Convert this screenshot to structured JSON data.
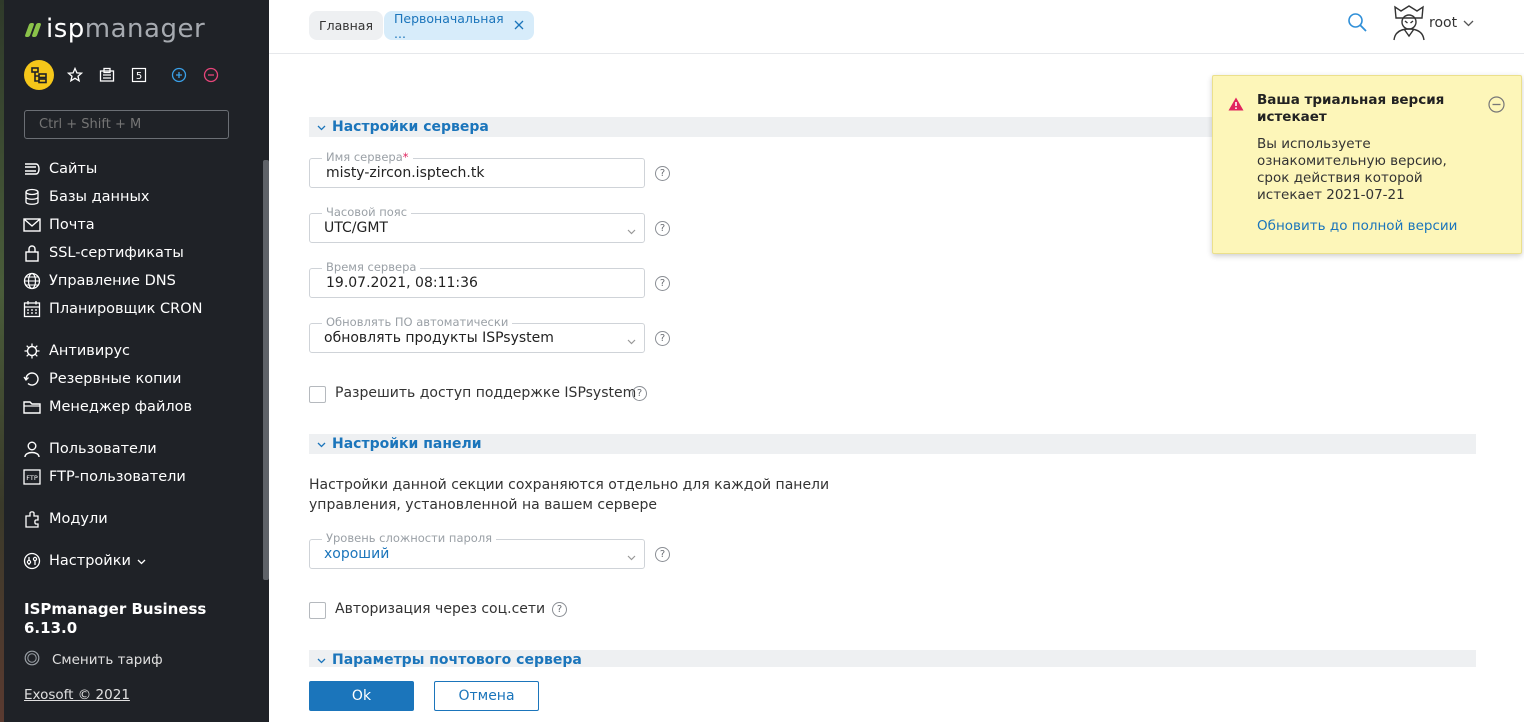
{
  "app": {
    "logo_isp": "isp",
    "logo_manager": "manager",
    "product_name": "ISPmanager Business 6.13.0",
    "change_tariff": "Сменить тариф",
    "copyright": "Exosoft © 2021",
    "quick_badge": "5"
  },
  "search": {
    "placeholder": "Ctrl + Shift + M"
  },
  "sidebar": {
    "items": [
      {
        "label": "Сайты"
      },
      {
        "label": "Базы данных"
      },
      {
        "label": "Почта"
      },
      {
        "label": "SSL-сертификаты"
      },
      {
        "label": "Управление DNS"
      },
      {
        "label": "Планировщик CRON"
      },
      {
        "label": "Антивирус"
      },
      {
        "label": "Резервные копии"
      },
      {
        "label": "Менеджер файлов"
      },
      {
        "label": "Пользователи"
      },
      {
        "label": "FTP-пользователи"
      },
      {
        "label": "Модули"
      },
      {
        "label": "Настройки"
      }
    ]
  },
  "breadcrumbs": {
    "home": "Главная",
    "current": "Первоначальная ..."
  },
  "user": {
    "name": "root"
  },
  "sections": {
    "server": "Настройки сервера",
    "panel": "Настройки панели",
    "mail": "Параметры почтового сервера"
  },
  "form": {
    "server_name": {
      "label": "Имя сервера",
      "required": "*",
      "value": "misty-zircon.isptech.tk"
    },
    "timezone": {
      "label": "Часовой пояс",
      "value": "UTC/GMT"
    },
    "server_time": {
      "label": "Время сервера",
      "value": "19.07.2021, 08:11:36"
    },
    "auto_update": {
      "label": "Обновлять ПО автоматически",
      "value": "обновлять продукты ISPsystem"
    },
    "support_access": {
      "label": "Разрешить доступ поддержке ISPsystem",
      "checked": false
    },
    "panel_note": "Настройки данной секции сохраняются отдельно для каждой панели управления, установленной на вашем сервере",
    "password_level": {
      "label": "Уровень сложности пароля",
      "value": "хороший"
    },
    "social_auth": {
      "label": "Авторизация через соц.сети",
      "checked": false
    },
    "help_symbol": "?"
  },
  "buttons": {
    "ok": "Ok",
    "cancel": "Отмена"
  },
  "toast": {
    "title": "Ваша триальная версия истекает",
    "text": "Вы используете ознакомительную версию, срок действия которой истекает 2021-07-21",
    "link": "Обновить до полной версии"
  },
  "colors": {
    "accent": "#1b75bb",
    "sidebar_bg": "#1f2227",
    "toast_bg": "#fdf6b9",
    "warning": "#e0245e",
    "logo_green": "#8bc34a"
  },
  "icons": {
    "quick": [
      "tree-icon",
      "star-icon",
      "clipboard-icon",
      "badge-icon",
      "plus-circle-icon",
      "minus-circle-icon"
    ],
    "sidebar": [
      "sites-icon",
      "database-icon",
      "mail-icon",
      "ssl-icon",
      "dns-icon",
      "cron-icon",
      "antivirus-icon",
      "backup-icon",
      "folder-icon",
      "user-icon",
      "ftp-icon",
      "modules-icon",
      "settings-icon"
    ]
  }
}
